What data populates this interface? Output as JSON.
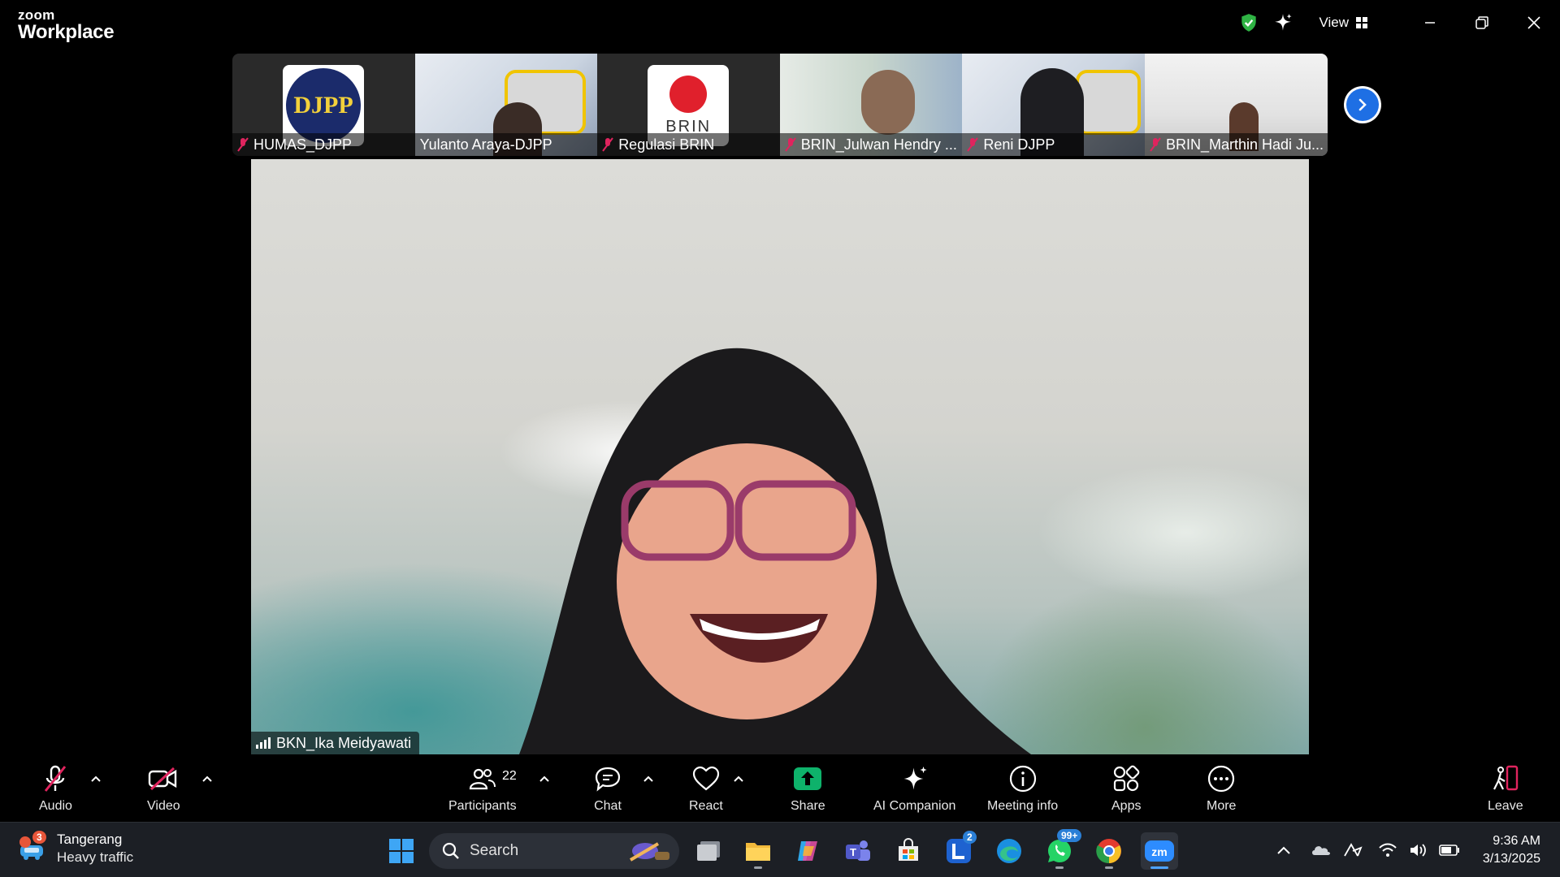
{
  "app": {
    "brand_top": "zoom",
    "brand_bottom": "Workplace"
  },
  "titlebar": {
    "view_label": "View",
    "icons": [
      "shield-check-icon",
      "sparkle-icon",
      "grid-icon",
      "minimize-icon",
      "restore-icon",
      "close-icon"
    ],
    "accent_green": "#2fb344"
  },
  "thumbnails": [
    {
      "name": "HUMAS_DJPP",
      "muted": true,
      "content": "DJPP logo"
    },
    {
      "name": "Yulanto Araya-DJPP",
      "muted": false,
      "content": "video"
    },
    {
      "name": "Regulasi BRIN",
      "muted": true,
      "content": "BRIN logo"
    },
    {
      "name": "BRIN_Julwan Hendry ...",
      "muted": true,
      "content": "video"
    },
    {
      "name": "Reni DJPP",
      "muted": true,
      "content": "video"
    },
    {
      "name": "BRIN_Marthin Hadi Ju...",
      "muted": true,
      "content": "video"
    }
  ],
  "thumb_text": {
    "djpp_logo": "DJPP",
    "brin_logo": "BRIN"
  },
  "main_video": {
    "speaker_name": "BKN_Ika Meidyawati"
  },
  "controls": {
    "audio": "Audio",
    "video": "Video",
    "participants": "Participants",
    "participants_count": "22",
    "chat": "Chat",
    "react": "React",
    "share": "Share",
    "ai_companion": "AI Companion",
    "meeting_info": "Meeting info",
    "apps": "Apps",
    "more": "More",
    "leave": "Leave",
    "muted_color": "#e0245e",
    "share_color": "#0eb26b",
    "leave_color": "#e0245e"
  },
  "taskbar": {
    "weather_badge": "3",
    "weather_city": "Tangerang",
    "weather_status": "Heavy traffic",
    "search_placeholder": "Search",
    "badge_l": "2",
    "badge_whatsapp": "99+",
    "time": "9:36 AM",
    "date": "3/13/2025"
  }
}
